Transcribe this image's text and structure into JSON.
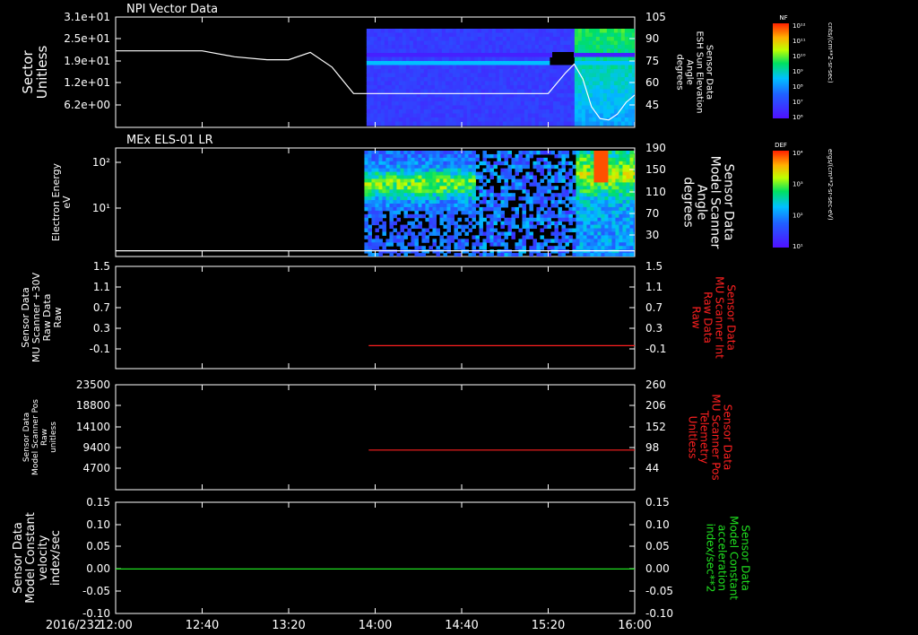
{
  "time_axis": {
    "date": "2016/232",
    "tick_labels": [
      "12:00",
      "12:40",
      "13:20",
      "14:00",
      "14:40",
      "15:20",
      "16:00"
    ],
    "start_min": 720,
    "end_min": 960
  },
  "colorbars": [
    {
      "title": "NF",
      "ticks": [
        "10¹²",
        "10¹¹",
        "10¹⁰",
        "10⁹",
        "10⁸",
        "10⁷",
        "10⁶"
      ],
      "units": "cnts/(cm**2-sr-sec)"
    },
    {
      "title": "DEF",
      "ticks": [
        "10⁴",
        "10³",
        "10²",
        "10¹"
      ],
      "units": "ergs/(cm**2-sr-sec-eV)"
    }
  ],
  "chart_data": [
    {
      "type": "heatmap",
      "title": "NPI Vector Data",
      "ylabel": [
        "Sector",
        "Unitless"
      ],
      "y_ticks": [
        "3.1e+01",
        "2.5e+01",
        "1.9e+01",
        "1.2e+01",
        "6.2e+00"
      ],
      "y2label": [
        "Sensor Data",
        "ESH Sun Elevation",
        "Angle",
        "degrees"
      ],
      "y2_ticks": [
        "105",
        "90",
        "75",
        "60",
        "45"
      ],
      "y2lim": [
        30,
        105
      ],
      "y2_color": "#ffffff",
      "data_start_time": "13:56",
      "line_series": {
        "name": "ESH Sun Elevation Angle",
        "time_min": [
          720,
          760,
          775,
          790,
          800,
          810,
          820,
          830,
          836,
          920,
          928,
          932,
          936,
          940,
          944,
          948,
          952,
          956,
          960
        ],
        "values": [
          82,
          82,
          78,
          76,
          76,
          81,
          71,
          53,
          53,
          53,
          67,
          73,
          63,
          44,
          36,
          35,
          39,
          47,
          52
        ]
      }
    },
    {
      "type": "heatmap",
      "title": "MEx ELS-01 LR",
      "ylabel": [
        "Electron Energy",
        "eV"
      ],
      "y_ticks": [
        "10²",
        "10¹"
      ],
      "y2label": [
        "Sensor Data",
        "Model Scanner",
        "Angle",
        "degrees"
      ],
      "y2_ticks": [
        "190",
        "150",
        "110",
        "70",
        "30"
      ],
      "y2lim": [
        0,
        190
      ],
      "y2_color": "#ffffff",
      "data_start_time": "13:55",
      "line_series": {
        "name": "Model Scanner Angle",
        "time_min": [
          720,
          960
        ],
        "values": [
          10,
          10
        ]
      }
    },
    {
      "type": "line",
      "ylabel": [
        "Sensor Data",
        "MU Scanner +30V",
        "Raw Data",
        "Raw"
      ],
      "y_ticks": [
        "1.5",
        "1.1",
        "0.7",
        "0.3",
        "-0.1"
      ],
      "ylim": [
        -0.5,
        1.5
      ],
      "y2label": [
        "Sensor Data",
        "MU Scanner Int",
        "Raw Data",
        "Raw"
      ],
      "y2_ticks": [
        "1.5",
        "1.1",
        "0.7",
        "0.3",
        "-0.1"
      ],
      "y2lim": [
        -0.5,
        1.5
      ],
      "y2_color": "#ff2020",
      "series": [
        {
          "name": "MU Scanner Int",
          "color": "#ff2020",
          "axis": "right",
          "time_min": [
            837,
            960
          ],
          "values": [
            -0.05,
            -0.05
          ]
        }
      ]
    },
    {
      "type": "line",
      "ylabel": [
        "Sensor Data",
        "Model Scanner Pos",
        "Raw",
        "unitless"
      ],
      "y_ticks": [
        "23500",
        "18800",
        "14100",
        "9400",
        "4700"
      ],
      "ylim": [
        0,
        23500
      ],
      "y2label": [
        "Sensor Data",
        "MU Scanner Pos",
        "Telemetry",
        "Unitless"
      ],
      "y2_ticks": [
        "260",
        "206",
        "152",
        "98",
        "44"
      ],
      "y2lim": [
        -10,
        260
      ],
      "y2_color": "#ff2020",
      "series": [
        {
          "name": "MU Scanner Pos Telemetry",
          "color": "#ff2020",
          "axis": "right",
          "time_min": [
            837,
            960
          ],
          "values": [
            92,
            92
          ]
        }
      ]
    },
    {
      "type": "line",
      "ylabel": [
        "Sensor Data",
        "Model Constant",
        "velocity",
        "index/sec"
      ],
      "y_ticks": [
        "0.15",
        "0.10",
        "0.05",
        "0.00",
        "-0.05",
        "-0.10"
      ],
      "ylim": [
        -0.1,
        0.15
      ],
      "y2label": [
        "Sensor Data",
        "Model Constant",
        "acceleration",
        "index/sec**2"
      ],
      "y2_ticks": [
        "0.15",
        "0.10",
        "0.05",
        "0.00",
        "-0.05",
        "-0.10"
      ],
      "y2lim": [
        -0.1,
        0.15
      ],
      "y2_color": "#20e020",
      "series": [
        {
          "name": "Model Constant acceleration",
          "color": "#20e020",
          "axis": "right",
          "time_min": [
            720,
            960
          ],
          "values": [
            0,
            0
          ]
        }
      ]
    }
  ]
}
